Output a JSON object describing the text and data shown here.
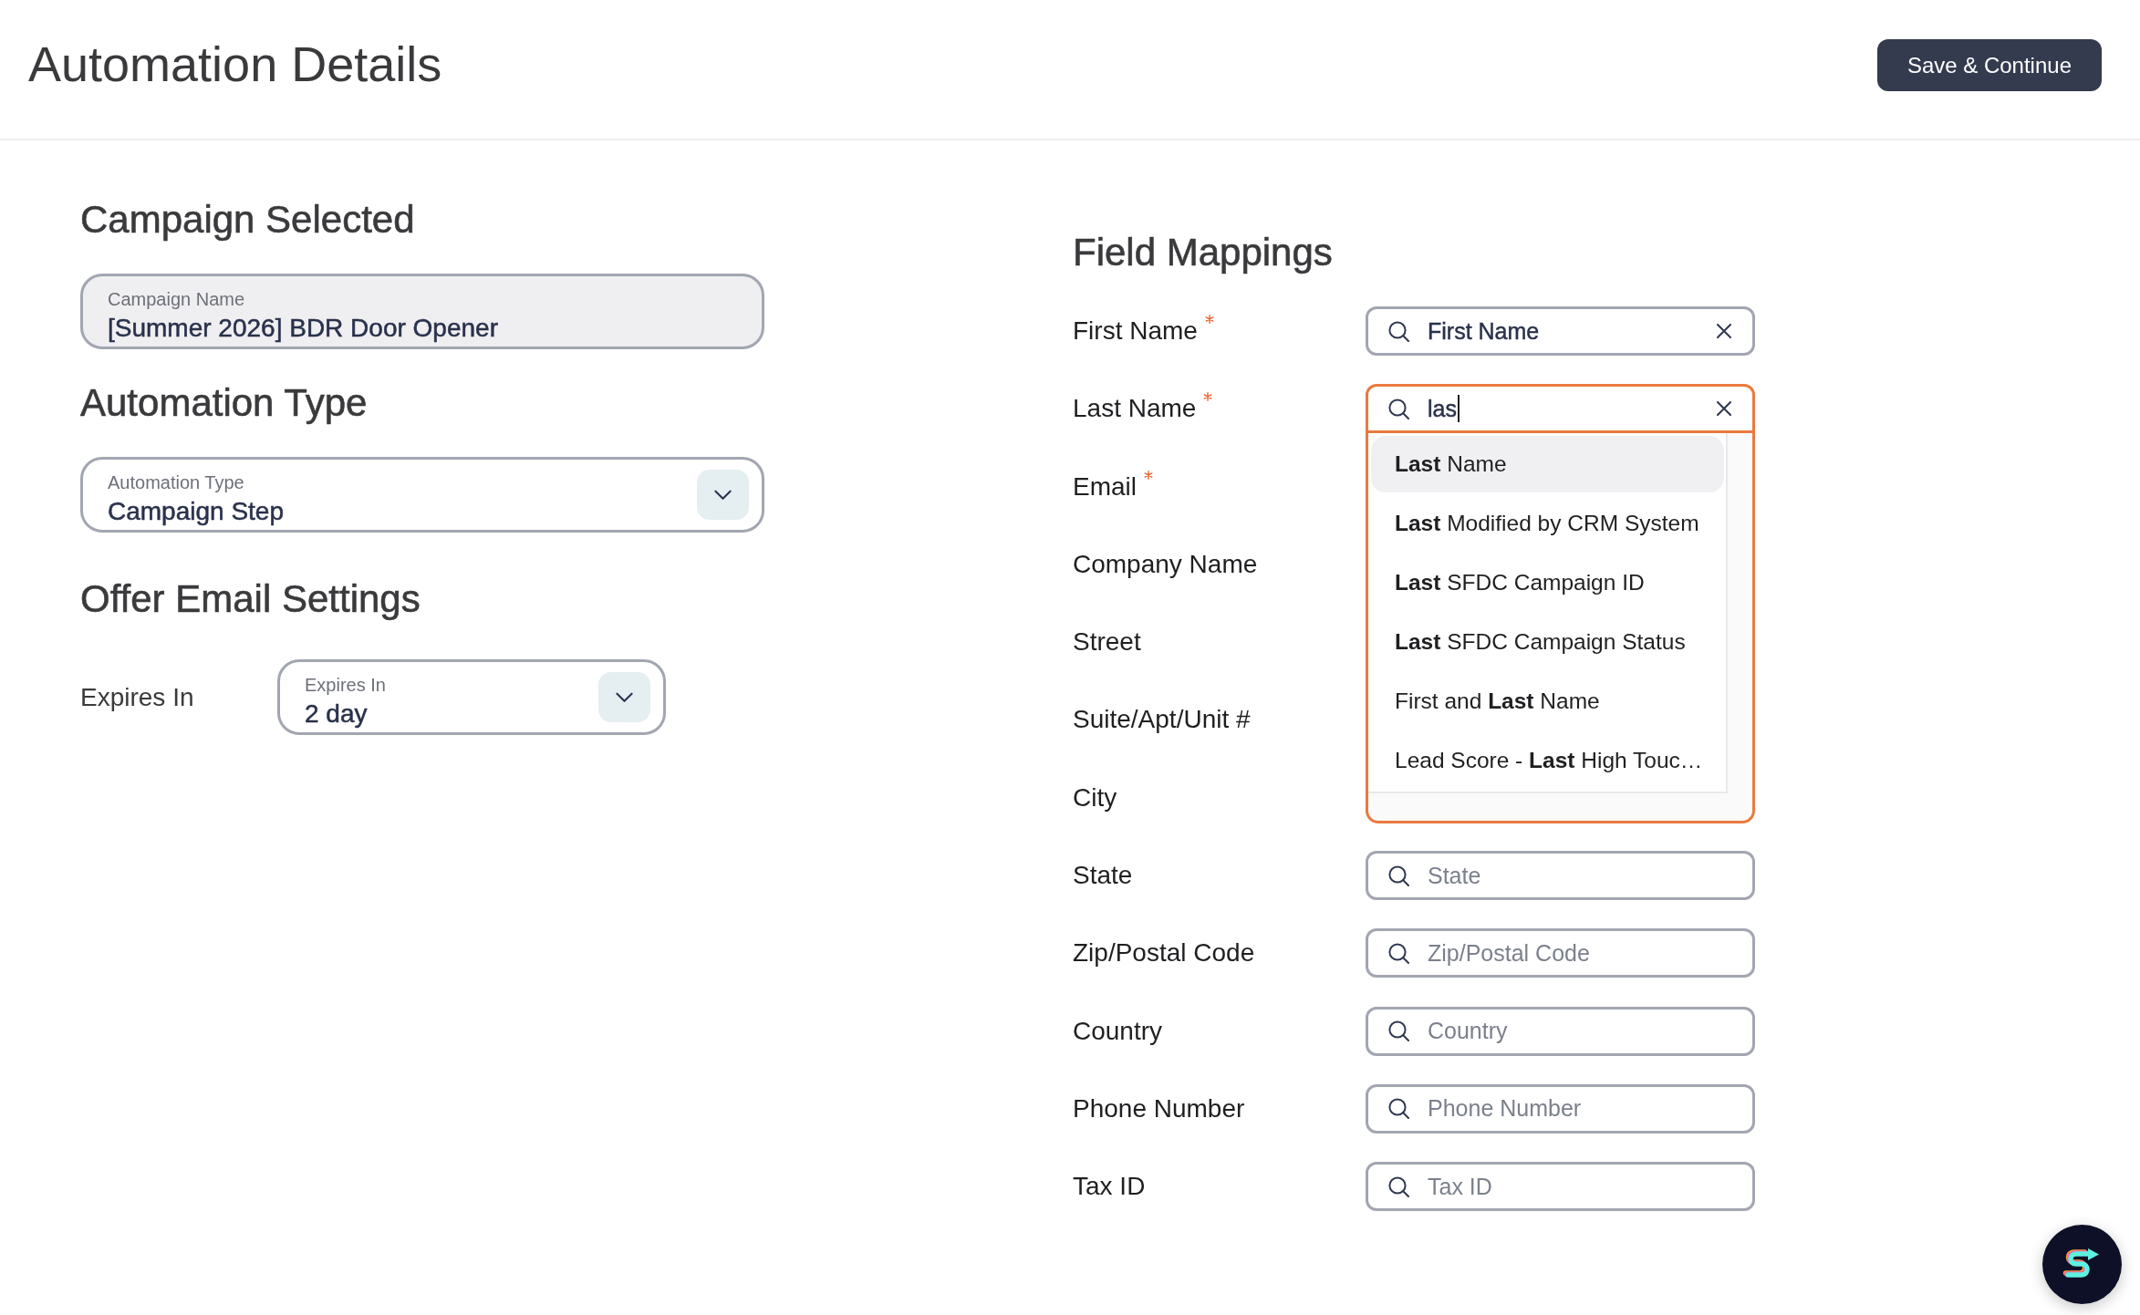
{
  "header": {
    "title": "Automation Details",
    "save_button": "Save & Continue"
  },
  "campaign_section": {
    "heading": "Campaign Selected",
    "field": {
      "label": "Campaign Name",
      "value": "[Summer 2026] BDR Door Opener",
      "disabled": true
    }
  },
  "automation_type_section": {
    "heading": "Automation Type",
    "select": {
      "label": "Automation Type",
      "value": "Campaign Step"
    }
  },
  "offer_email_section": {
    "heading": "Offer Email Settings",
    "rows": [
      {
        "label": "Expires In",
        "select": {
          "label": "Expires In",
          "value": "2 day"
        }
      }
    ]
  },
  "field_mappings": {
    "heading": "Field Mappings",
    "rows": [
      {
        "label": "First Name",
        "required": true,
        "field": {
          "value": "First Name",
          "focused": false
        }
      },
      {
        "label": "Last Name",
        "required": true,
        "field": {
          "value": "las",
          "focused": true,
          "dropdown": {
            "options": [
              {
                "label": "**Last** Name",
                "selected": true
              },
              {
                "label": "**Last** Modified by CRM System",
                "selected": false
              },
              {
                "label": "**Last** SFDC Campaign ID",
                "selected": false
              },
              {
                "label": "**Last** SFDC Campaign Status",
                "selected": false
              },
              {
                "label": "First and **Last** Name",
                "selected": false
              },
              {
                "label": "Lead Score - **Last** High Touc…",
                "selected": false
              }
            ]
          }
        }
      },
      {
        "label": "Email",
        "required": true
      },
      {
        "label": "Company Name",
        "required": false
      },
      {
        "label": "Street",
        "required": false
      },
      {
        "label": "Suite/Apt/Unit #",
        "required": false
      },
      {
        "label": "City",
        "required": false
      },
      {
        "label": "State",
        "required": false,
        "field": {
          "placeholder": "State",
          "focused": false
        }
      },
      {
        "label": "Zip/Postal Code",
        "required": false,
        "field": {
          "placeholder": "Zip/Postal Code",
          "focused": false
        }
      },
      {
        "label": "Country",
        "required": false,
        "field": {
          "placeholder": "Country",
          "focused": false
        }
      },
      {
        "label": "Phone Number",
        "required": false,
        "field": {
          "placeholder": "Phone Number",
          "focused": false
        }
      },
      {
        "label": "Tax ID",
        "required": false,
        "field": {
          "placeholder": "Tax ID",
          "focused": false
        }
      }
    ]
  }
}
